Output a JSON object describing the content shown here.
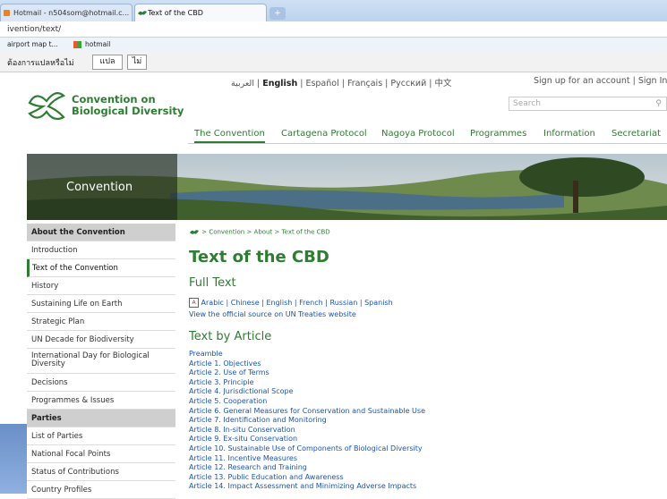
{
  "browser": {
    "tabs": [
      {
        "label": "Hotmail - n504som@hotmail.c..."
      },
      {
        "label": "Text of the CBD"
      }
    ],
    "new_tab_label": "+",
    "address": "ivention/text/",
    "bookmarks": [
      "airport map t...",
      "hotmail"
    ],
    "translate_prompt": "ต้องการแปลหรือไม่",
    "translate_button": "แปล",
    "no_button": "ไม่"
  },
  "header": {
    "languages": [
      "العربية",
      "English",
      "Español",
      "Français",
      "Русский",
      "中文"
    ],
    "account": "Sign up for an account | Sign In",
    "search_placeholder": "Search",
    "logo_line1": "Convention on",
    "logo_line2": "Biological Diversity"
  },
  "nav": [
    "The Convention",
    "Cartagena Protocol",
    "Nagoya Protocol",
    "Programmes",
    "Information",
    "Secretariat"
  ],
  "banner": {
    "title": "Convention"
  },
  "sidebar": {
    "items": [
      {
        "label": "About the Convention"
      },
      {
        "label": "Introduction"
      },
      {
        "label": "Text of the Convention"
      },
      {
        "label": "History"
      },
      {
        "label": "Sustaining Life on Earth"
      },
      {
        "label": "Strategic Plan"
      },
      {
        "label": "UN Decade for Biodiversity"
      },
      {
        "label": "International Day for Biological Diversity"
      },
      {
        "label": "Decisions"
      },
      {
        "label": "Programmes & Issues"
      },
      {
        "label": "Parties"
      },
      {
        "label": "List of Parties"
      },
      {
        "label": "National Focal Points"
      },
      {
        "label": "Status of Contributions"
      },
      {
        "label": "Country Profiles"
      }
    ]
  },
  "content": {
    "breadcrumb": "> Convention > About > Text of the CBD",
    "title": "Text of the CBD",
    "full_text_heading": "Full Text",
    "languages": [
      "Arabic",
      "Chinese",
      "English",
      "French",
      "Russian",
      "Spanish"
    ],
    "official_link": "View the official source on UN Treaties website",
    "by_article_heading": "Text by Article",
    "articles": [
      "Preamble",
      "Article 1. Objectives",
      "Article 2. Use of Terms",
      "Article 3. Principle",
      "Article 4. Jurisdictional Scope",
      "Article 5. Cooperation",
      "Article 6. General Measures for Conservation and Sustainable Use",
      "Article 7. Identification and Monitoring",
      "Article 8. In-situ Conservation",
      "Article 9. Ex-situ Conservation",
      "Article 10. Sustainable Use of Components of Biological Diversity",
      "Article 11. Incentive Measures",
      "Article 12. Research and Training",
      "Article 13. Public Education and Awareness",
      "Article 14. Impact Assessment and Minimizing Adverse Impacts"
    ]
  },
  "colors": {
    "brand_green": "#2e7d32",
    "link_blue": "#1a56b0"
  }
}
